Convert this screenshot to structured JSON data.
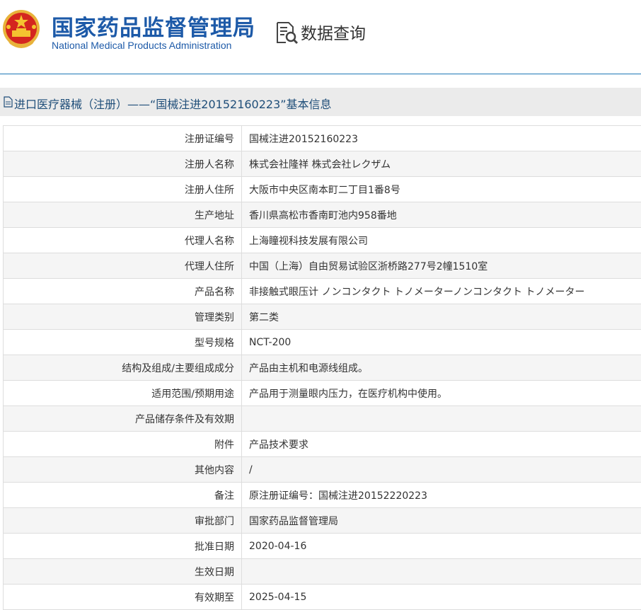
{
  "header": {
    "title_cn": "国家药品监督管理局",
    "title_en": "National Medical Products Administration",
    "emblem_icon": "national-emblem-icon",
    "data_query_label": "数据查询",
    "data_query_icon": "document-search-icon"
  },
  "section": {
    "icon": "document-icon",
    "title": "进口医疗器械（注册）——“国械注进20152160223”基本信息"
  },
  "rows": [
    {
      "label": "注册证编号",
      "value": "国械注进20152160223"
    },
    {
      "label": "注册人名称",
      "value": "株式会社隆祥 株式会社レクザム"
    },
    {
      "label": "注册人住所",
      "value": "大阪市中央区南本町二丁目1番8号"
    },
    {
      "label": "生产地址",
      "value": "香川県高松市香南町池内958番地"
    },
    {
      "label": "代理人名称",
      "value": "上海瞳视科技发展有限公司"
    },
    {
      "label": "代理人住所",
      "value": "中国（上海）自由贸易试验区浙桥路277号2幢1510室"
    },
    {
      "label": "产品名称",
      "value": "非接触式眼压计 ノンコンタクト トノメーターノンコンタクト トノメーター"
    },
    {
      "label": "管理类别",
      "value": "第二类"
    },
    {
      "label": "型号规格",
      "value": "NCT-200"
    },
    {
      "label": "结构及组成/主要组成成分",
      "value": "产品由主机和电源线组成。"
    },
    {
      "label": "适用范围/预期用途",
      "value": "产品用于测量眼内压力，在医疗机构中使用。"
    },
    {
      "label": "产品储存条件及有效期",
      "value": ""
    },
    {
      "label": "附件",
      "value": "产品技术要求"
    },
    {
      "label": "其他内容",
      "value": "/"
    },
    {
      "label": "备注",
      "value": "原注册证编号：国械注进20152220223"
    },
    {
      "label": "审批部门",
      "value": "国家药品监督管理局"
    },
    {
      "label": "批准日期",
      "value": "2020-04-16"
    },
    {
      "label": "生效日期",
      "value": ""
    },
    {
      "label": "有效期至",
      "value": "2025-04-15"
    }
  ],
  "colors": {
    "brand_blue": "#1d5aa8",
    "divider_blue": "#1e77b6",
    "section_bg": "#ebebeb",
    "row_alt_bg": "#f5f5f5",
    "border": "#dddddd"
  }
}
